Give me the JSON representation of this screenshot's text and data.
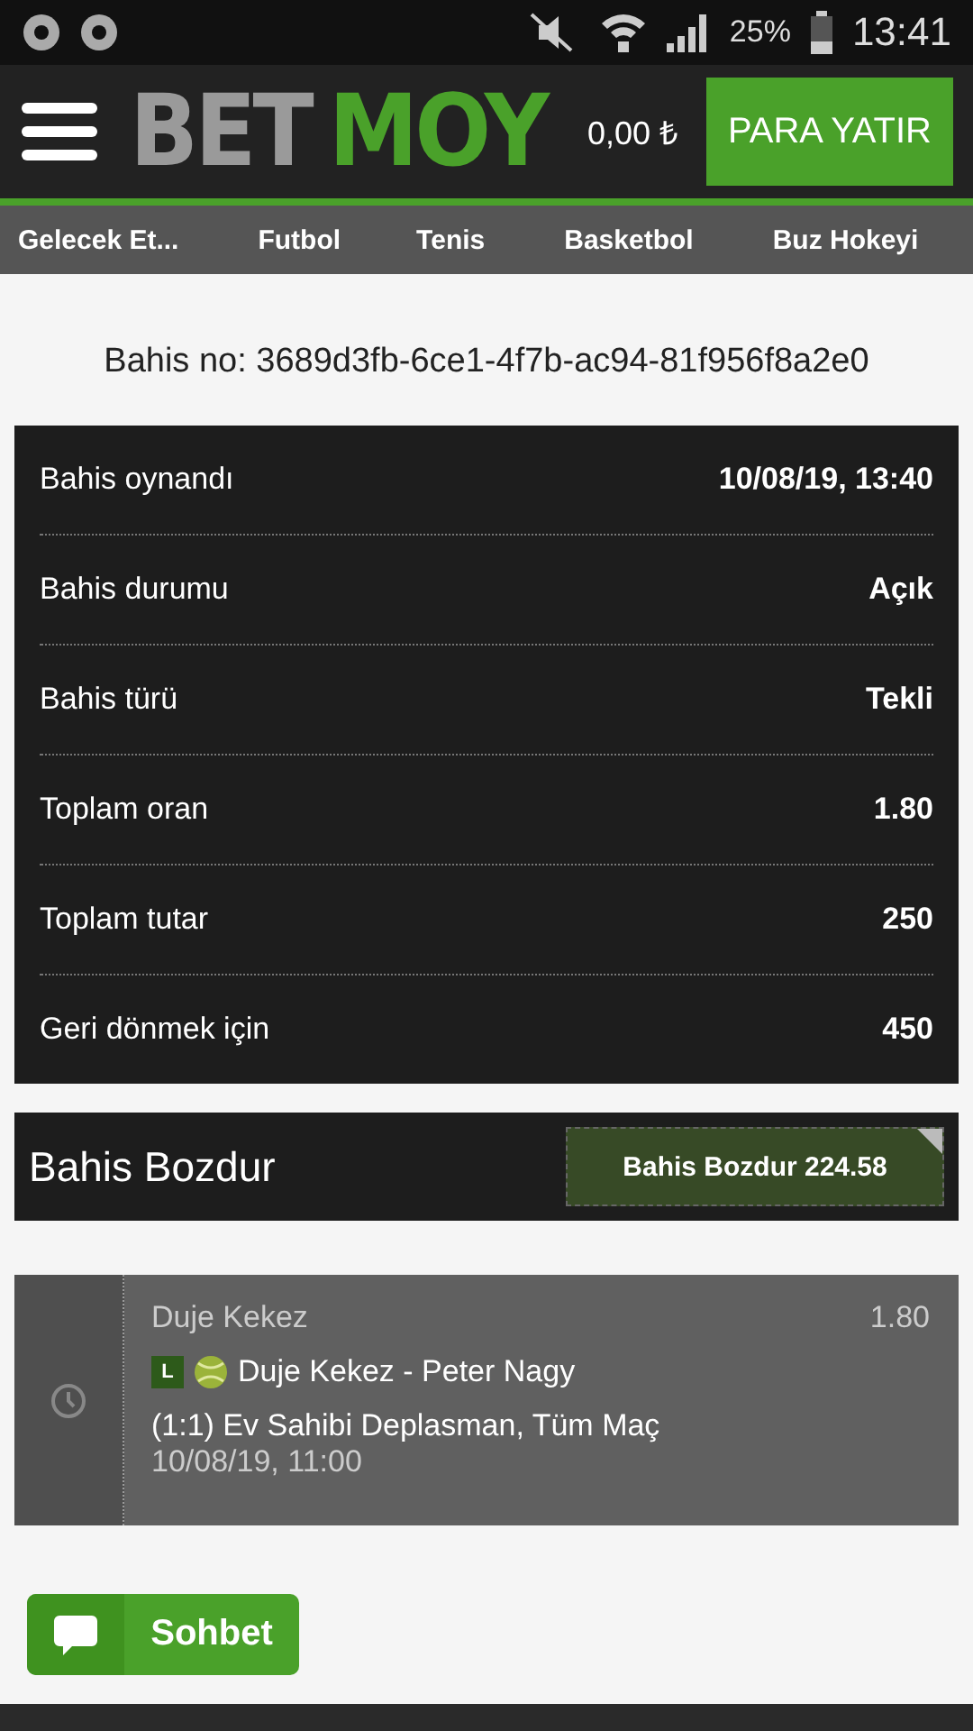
{
  "status_bar": {
    "battery": "25%",
    "time": "13:41"
  },
  "header": {
    "logo_left": "BET",
    "logo_right": "MOY",
    "balance": "0,00 ₺",
    "deposit_button": "PARA YATIR"
  },
  "tabs": [
    {
      "label": "Gelecek Et..."
    },
    {
      "label": "Futbol"
    },
    {
      "label": "Tenis"
    },
    {
      "label": "Basketbol"
    },
    {
      "label": "Buz Hokeyi"
    }
  ],
  "bet_id": "Bahis no: 3689d3fb-6ce1-4f7b-ac94-81f956f8a2e0",
  "details": [
    {
      "label": "Bahis oynandı",
      "value": "10/08/19, 13:40"
    },
    {
      "label": "Bahis durumu",
      "value": "Açık"
    },
    {
      "label": "Bahis türü",
      "value": "Tekli"
    },
    {
      "label": "Toplam oran",
      "value": "1.80"
    },
    {
      "label": "Toplam tutar",
      "value": "250"
    },
    {
      "label": "Geri dönmek için",
      "value": "450"
    }
  ],
  "cashout": {
    "title": "Bahis Bozdur",
    "button": "Bahis Bozdur 224.58"
  },
  "selection": {
    "player": "Duje Kekez",
    "odds": "1.80",
    "live_badge": "L",
    "match": "Duje Kekez - Peter Nagy",
    "market": "(1:1) Ev Sahibi Deplasman, Tüm Maç",
    "date": "10/08/19, 11:00"
  },
  "chat_button": "Sohbet"
}
